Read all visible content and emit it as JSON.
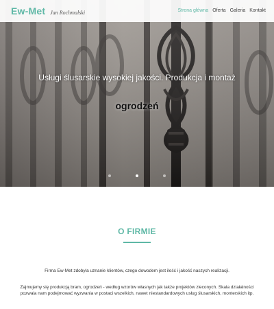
{
  "header": {
    "brand": "Ew-Met",
    "owner": "Jan Rochmalski",
    "nav": [
      {
        "label": "Strona główna",
        "active": true
      },
      {
        "label": "Oferta",
        "active": false
      },
      {
        "label": "Galeria",
        "active": false
      },
      {
        "label": "Kontakt",
        "active": false
      }
    ]
  },
  "hero": {
    "title": "Usługi ślusarskie wysokiej jakości. Produkcja i montaż",
    "subtitle": "ogrodzeń",
    "slides_total": 3,
    "active_slide": 1
  },
  "about": {
    "title": "O FIRMIE",
    "paragraph1": "Firma Ew-Met zdobyła uznanie klientów, czego dowodem jest ilość i jakość naszych realizacji.",
    "paragraph2": "Zajmujemy się produkcją bram, ogrodzeń - według wzorów własnych jak także projektów zleconych. Skala działalności pozwala nam podejmować wyzwania w postaci wszelkich, nawet niestandardowych usług ślusarskich, monterskich itp."
  },
  "colors": {
    "accent": "#5fb8a6",
    "text": "#333333"
  }
}
